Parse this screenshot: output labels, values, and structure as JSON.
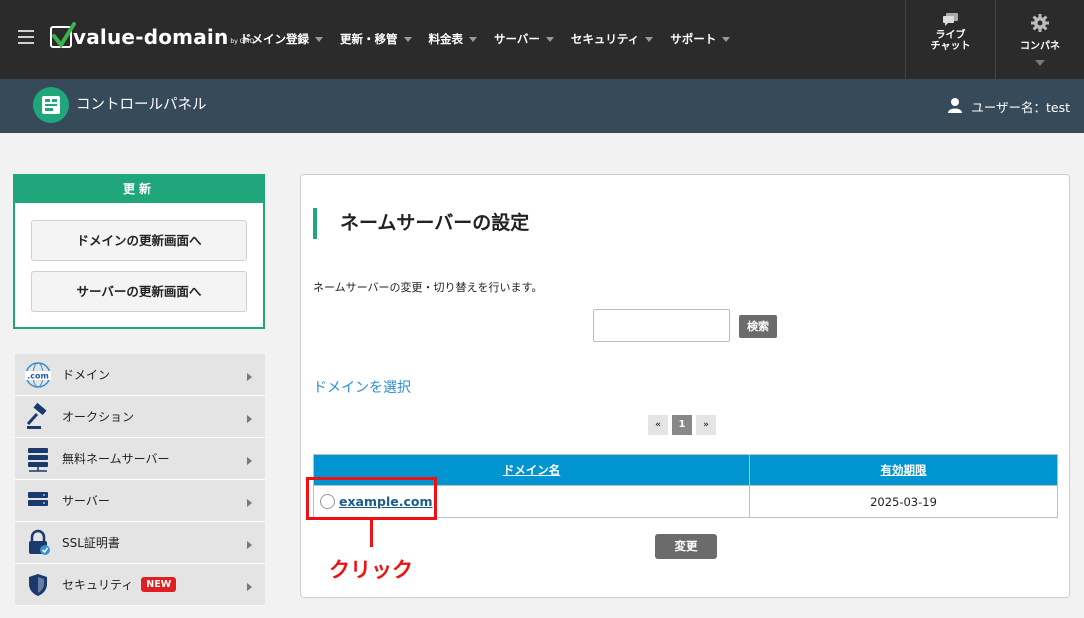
{
  "header": {
    "logo_text": "value-domain",
    "logo_sub": "by GMO",
    "nav": [
      "ドメイン登録",
      "更新・移管",
      "料金表",
      "サーバー",
      "セキュリティ",
      "サポート"
    ],
    "chat_label_1": "ライブ",
    "chat_label_2": "チャット",
    "panel_label": "コンパネ",
    "icons": {
      "menu": "hamburger-icon",
      "chat": "chat-icon",
      "panel": "gear-icon"
    }
  },
  "subheader": {
    "title": "コントロールパネル",
    "user": "ユーザー名：test"
  },
  "sidebar": {
    "renew_title": "更新",
    "renew_domain": "ドメインの更新画面へ",
    "renew_server": "サーバーの更新画面へ",
    "items": [
      {
        "label": "ドメイン",
        "icon": "globe-com-icon"
      },
      {
        "label": "オークション",
        "icon": "gavel-icon"
      },
      {
        "label": "無料ネームサーバー",
        "icon": "nameserver-icon"
      },
      {
        "label": "サーバー",
        "icon": "server-icon"
      },
      {
        "label": "SSL証明書",
        "icon": "ssl-lock-icon"
      },
      {
        "label": "セキュリティ",
        "icon": "shield-icon",
        "badge": "NEW"
      }
    ]
  },
  "main": {
    "title": "ネームサーバーの設定",
    "description": "ネームサーバーの変更・切り替えを行います。",
    "search_value": "",
    "search_button": "検索",
    "select_heading": "ドメインを選択",
    "pager": {
      "prev": "«",
      "current": "1",
      "next": "»"
    },
    "table": {
      "headers": [
        "ドメイン名",
        "有効期限"
      ],
      "rows": [
        {
          "domain": "example.com",
          "expires": "2025-03-19"
        }
      ]
    },
    "change_button": "変更"
  },
  "annotation": {
    "text": "クリック",
    "color": "#ee1111"
  },
  "colors": {
    "accent_green": "#20a67b",
    "table_header": "#0095d0",
    "topbar": "#2b2b2b",
    "subbar": "#374a5a"
  }
}
